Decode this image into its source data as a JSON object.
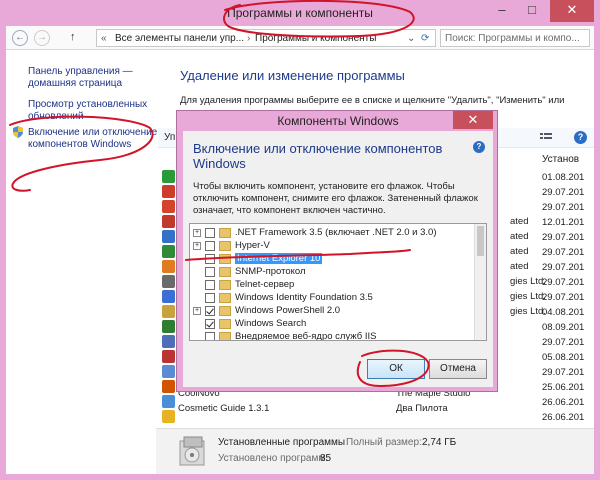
{
  "window": {
    "title": "Программы и компоненты",
    "minimize": "–",
    "maximize": "□",
    "close": "✕"
  },
  "nav": {
    "back": "←",
    "forward": "→",
    "up": "↑",
    "crumb_icon": "«",
    "crumb1": "Все элементы панели упр...",
    "crumb_sep": "›",
    "crumb2": "Программы и компоненты",
    "crumb_dropdown": "⌄",
    "refresh": "⟳",
    "search_placeholder": "Поиск: Программы и компо..."
  },
  "sidebar": {
    "home": "Панель управления — домашняя страница",
    "updates": "Просмотр установленных обновлений",
    "features": "Включение или отключение компонентов Windows"
  },
  "main": {
    "heading": "Удаление или изменение программы",
    "description": "Для удаления программы выберите ее в списке и щелкните \"Удалить\", \"Изменить\" или",
    "toolbar_left": "Уп",
    "column_installed": "Установ",
    "rows_right_text": [
      "ated",
      "ated",
      "ated",
      "ated",
      "gies Ltd.",
      "gies Ltd.",
      "gies Ltd."
    ],
    "dates": [
      "01.08.201",
      "29.07.201",
      "29.07.201",
      "12.01.201",
      "29.07.201",
      "29.07.201",
      "29.07.201",
      "29.07.201",
      "29.07.201",
      "04.08.201",
      "08.09.201",
      "29.07.201",
      "05.08.201",
      "29.07.201",
      "25.06.201",
      "26.06.201",
      "26.06.201"
    ],
    "prog1_name": "CoolNovo",
    "prog1_pub": "The Maple Studio",
    "prog2_name": "Cosmetic Guide 1.3.1",
    "prog2_pub": "Два Пилота",
    "help": "?"
  },
  "footer": {
    "installed_label": "Установленные программы",
    "total_size_label": "Полный размер:",
    "total_size_value": "2,74 ГБ",
    "count_label": "Установлено программ:",
    "count_value": "85"
  },
  "dialog": {
    "title": "Компоненты Windows",
    "close": "✕",
    "heading": "Включение или отключение компонентов Windows",
    "help": "?",
    "text": "Чтобы включить компонент, установите его флажок. Чтобы отключить компонент, снимите его флажок. Затененный флажок означает, что компонент включен частично.",
    "features": [
      {
        "label": ".NET Framework 3.5 (включает .NET 2.0 и 3.0)",
        "expand": "+",
        "checked": false
      },
      {
        "label": "Hyper-V",
        "expand": "+",
        "checked": false
      },
      {
        "label": "Internet Explorer 10",
        "expand": "",
        "checked": false
      },
      {
        "label": "SNMP-протокол",
        "expand": "",
        "checked": false
      },
      {
        "label": "Telnet-сервер",
        "expand": "",
        "checked": false
      },
      {
        "label": "Windows Identity Foundation 3.5",
        "expand": "",
        "checked": false
      },
      {
        "label": "Windows PowerShell 2.0",
        "expand": "+",
        "checked": true
      },
      {
        "label": "Windows Search",
        "expand": "",
        "checked": true
      },
      {
        "label": "Внедряемое веб-ядро служб IIS",
        "expand": "",
        "checked": false
      }
    ],
    "ok": "ОК",
    "cancel": "Отмена"
  },
  "colors": {
    "frame": "#e9a9d8",
    "link": "#1e3287",
    "heading": "#1e3a8a",
    "annotation": "#d1142a"
  }
}
